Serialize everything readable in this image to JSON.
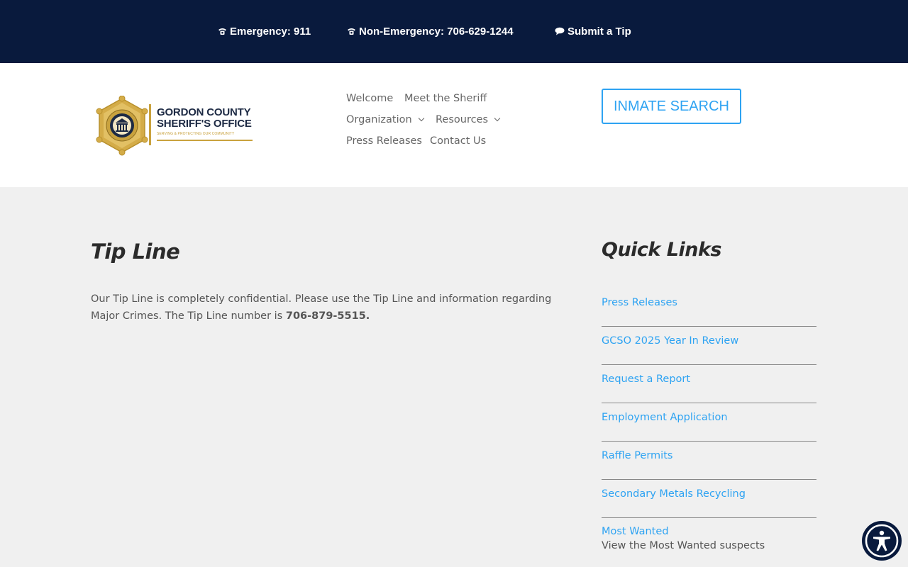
{
  "topbar": {
    "emergency": "Emergency: 911",
    "non_emergency": "Non-Emergency: 706-629-1244",
    "tip": "Submit a Tip"
  },
  "logo": {
    "line1": "GORDON COUNTY",
    "line2": "SHERIFF'S OFFICE",
    "tagline": "SERVING & PROTECTING OUR COMMUNITY"
  },
  "nav": {
    "welcome": "Welcome",
    "sheriff": "Meet the Sheriff",
    "organization": "Organization",
    "resources": "Resources",
    "press": "Press Releases",
    "contact": "Contact Us"
  },
  "inmate_search": "INMATE SEARCH",
  "main": {
    "title": "Tip Line",
    "text": "Our Tip Line is completely confidential. Please use the Tip Line and information regarding Major Crimes. The Tip Line number is ",
    "number": "706-879-5515."
  },
  "sidebar": {
    "title": "Quick Links",
    "links": [
      {
        "label": "Press Releases"
      },
      {
        "label": "GCSO 2025 Year In Review"
      },
      {
        "label": "Request a Report"
      },
      {
        "label": "Employment Application"
      },
      {
        "label": "Raffle Permits"
      },
      {
        "label": "Secondary Metals Recycling"
      },
      {
        "label": "Most Wanted",
        "desc": "View the Most Wanted suspects"
      }
    ]
  },
  "colors": {
    "navy": "#091a3d",
    "link_blue": "#2ea3f2",
    "gold": "#c9a23e"
  },
  "icons": {
    "phone": "phone-icon",
    "chat": "chat-bubble-icon",
    "accessibility": "accessibility-icon"
  }
}
